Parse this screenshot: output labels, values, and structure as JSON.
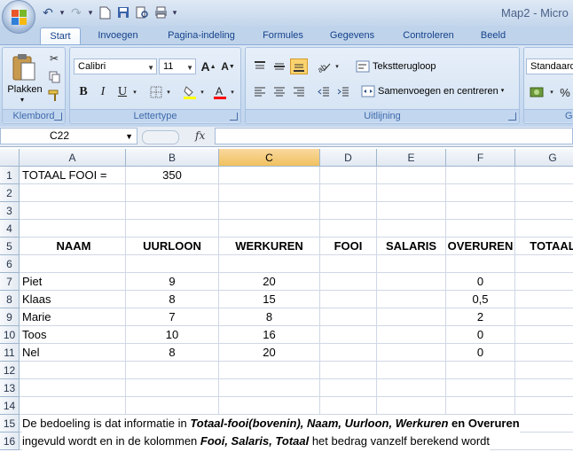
{
  "window": {
    "title": "Map2 - Micro"
  },
  "quick_access": {
    "icons": [
      "undo-icon",
      "redo-icon",
      "new-icon",
      "save-icon",
      "print-preview-icon",
      "print-icon",
      "customize-icon"
    ]
  },
  "tabs": [
    {
      "label": "Start",
      "active": true
    },
    {
      "label": "Invoegen"
    },
    {
      "label": "Pagina-indeling"
    },
    {
      "label": "Formules"
    },
    {
      "label": "Gegevens"
    },
    {
      "label": "Controleren"
    },
    {
      "label": "Beeld"
    }
  ],
  "ribbon": {
    "clipboard": {
      "label": "Klembord",
      "paste": "Plakken"
    },
    "font": {
      "label": "Lettertype",
      "name": "Calibri",
      "size": "11",
      "bold": "B",
      "italic": "I",
      "underline": "U",
      "grow": "A",
      "shrink": "A",
      "fill_color": "#ffff00",
      "font_color": "#ff0000"
    },
    "alignment": {
      "label": "Uitlijning",
      "wrap": "Tekstterugloop",
      "merge": "Samenvoegen en centreren"
    },
    "number": {
      "label": "Ge",
      "format": "Standaard",
      "percent": "%"
    }
  },
  "formula_bar": {
    "cell_ref": "C22",
    "fx": "fx",
    "content": ""
  },
  "sheet": {
    "columns": [
      "A",
      "B",
      "C",
      "D",
      "E",
      "F",
      "G"
    ],
    "selected_column": "C",
    "rows": [
      "1",
      "2",
      "3",
      "4",
      "5",
      "6",
      "7",
      "8",
      "9",
      "10",
      "11",
      "12",
      "13",
      "14",
      "15",
      "16"
    ],
    "cells": {
      "A1": "TOTAAL FOOI =",
      "B1": "350",
      "A5": "NAAM",
      "B5": "UURLOON",
      "C5": "WERKUREN",
      "D5": "FOOI",
      "E5": "SALARIS",
      "F5": "OVERUREN",
      "G5": "TOTAAL",
      "A7": "Piet",
      "B7": "9",
      "C7": "20",
      "F7": "0",
      "A8": "Klaas",
      "B8": "8",
      "C8": "15",
      "F8": "0,5",
      "A9": "Marie",
      "B9": "7",
      "C9": "8",
      "F9": "2",
      "A10": "Toos",
      "B10": "10",
      "C10": "16",
      "F10": "0",
      "A11": "Nel",
      "B11": "8",
      "C11": "20",
      "F11": "0"
    },
    "note_row15": {
      "p1": "De bedoeling is dat informatie in ",
      "p2": "Totaal-fooi(bovenin), Naam, Uurloon, Werkuren",
      "p3": " en ",
      "p4": "Overuren"
    },
    "note_row16": {
      "p1": "ingevuld wordt en in de kolommen ",
      "p2": "Fooi, Salaris, Totaal",
      "p3": "  het bedrag vanzelf berekend wordt"
    }
  }
}
